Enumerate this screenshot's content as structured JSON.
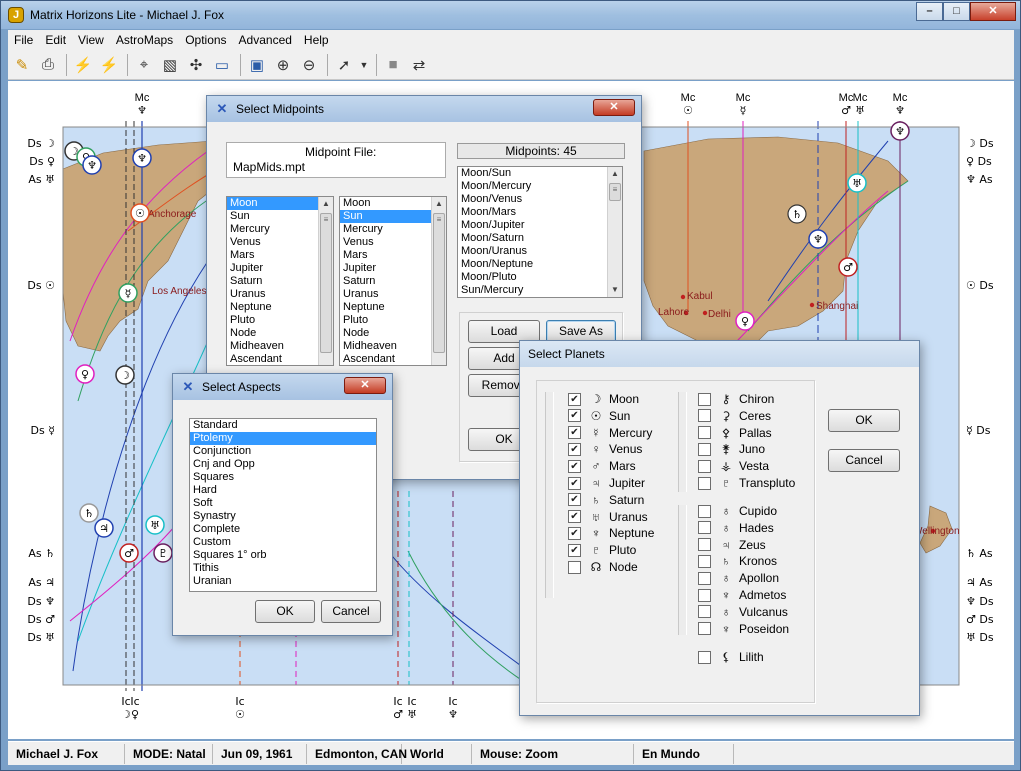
{
  "app": {
    "title": "Matrix Horizons Lite - Michael J. Fox",
    "icon_name": "app-logo-icon"
  },
  "window_controls": {
    "minimize": "–",
    "maximize": "□",
    "close": "✕"
  },
  "menu": [
    "File",
    "Edit",
    "View",
    "AstroMaps",
    "Options",
    "Advanced",
    "Help"
  ],
  "toolbar_icons": [
    "edit-chart-icon",
    "print-icon",
    "animate-icon",
    "animate-back-icon",
    "map-tool-icon",
    "select-region-icon",
    "planet-lines-icon",
    "screen-icon",
    "full-map-icon",
    "zoom-in-icon",
    "zoom-out-icon",
    "pointer-icon",
    "dropdown-arrow-icon",
    "stop-icon",
    "refresh-icon"
  ],
  "map": {
    "ocean_color": "#c9def5",
    "land_color": "#c9a77b",
    "cities": [
      "Anchorage",
      "Los Angeles",
      "Kabul",
      "Lahore",
      "Delhi",
      "Shanghai",
      "Wellington"
    ],
    "top_labels": [
      "Mc",
      "Mc",
      "Mc",
      "Mc",
      "Mc",
      "Mc",
      "Mc"
    ],
    "top_symbols": [
      "♆",
      "☉",
      "☿",
      "♂",
      "♅",
      "♆"
    ],
    "left_labels": [
      {
        "ang": "Ds",
        "sym": "☽"
      },
      {
        "ang": "Ds",
        "sym": "♀"
      },
      {
        "ang": "As",
        "sym": "♅"
      },
      {
        "ang": "Ds",
        "sym": "☉"
      },
      {
        "ang": "Ds",
        "sym": "☿"
      },
      {
        "ang": "As",
        "sym": "♄"
      },
      {
        "ang": "As",
        "sym": "♃"
      },
      {
        "ang": "Ds",
        "sym": "♆"
      },
      {
        "ang": "Ds",
        "sym": "♂"
      },
      {
        "ang": "Ds",
        "sym": "♅"
      }
    ],
    "right_labels": [
      {
        "ang": "Ds",
        "sym": "☽"
      },
      {
        "ang": "Ds",
        "sym": "♀"
      },
      {
        "ang": "As",
        "sym": "♆"
      },
      {
        "ang": "Ds",
        "sym": "☉"
      },
      {
        "ang": "Ds",
        "sym": "☿"
      },
      {
        "ang": "As",
        "sym": "♄"
      },
      {
        "ang": "As",
        "sym": "♃"
      },
      {
        "ang": "Ds",
        "sym": "♆"
      },
      {
        "ang": "Ds",
        "sym": "♂"
      },
      {
        "ang": "Ds",
        "sym": "♅"
      }
    ],
    "bottom_labels": [
      {
        "ang": "Ic",
        "sym": "☽"
      },
      {
        "ang": "Ic",
        "sym": "♀"
      },
      {
        "ang": "Ic",
        "sym": "☉"
      },
      {
        "ang": "Ic",
        "sym": "♂"
      },
      {
        "ang": "Ic",
        "sym": "♅"
      },
      {
        "ang": "Ic",
        "sym": "♆"
      }
    ]
  },
  "midpoints_dialog": {
    "title": "Select Midpoints",
    "file_label": "Midpoint File:",
    "file_value": "MapMids.mpt",
    "count_label": "Midpoints: 45",
    "list_a": [
      "Moon",
      "Sun",
      "Mercury",
      "Venus",
      "Mars",
      "Jupiter",
      "Saturn",
      "Uranus",
      "Neptune",
      "Pluto",
      "Node",
      "Midheaven",
      "Ascendant"
    ],
    "list_a_selected": "Moon",
    "list_b": [
      "Moon",
      "Sun",
      "Mercury",
      "Venus",
      "Mars",
      "Jupiter",
      "Saturn",
      "Uranus",
      "Neptune",
      "Pluto",
      "Node",
      "Midheaven",
      "Ascendant"
    ],
    "list_b_selected": "Sun",
    "pairs": [
      "Moon/Sun",
      "Moon/Mercury",
      "Moon/Venus",
      "Moon/Mars",
      "Moon/Jupiter",
      "Moon/Saturn",
      "Moon/Uranus",
      "Moon/Neptune",
      "Moon/Pluto",
      "Sun/Mercury"
    ],
    "buttons": {
      "load": "Load",
      "save_as": "Save As",
      "add": "Add",
      "remove": "Remove",
      "ok": "OK"
    }
  },
  "aspects_dialog": {
    "title": "Select Aspects",
    "items": [
      "Standard",
      "Ptolemy",
      "Conjunction",
      "Cnj and Opp",
      "Squares",
      "Hard",
      "Soft",
      "Synastry",
      "Complete",
      "Custom",
      "Squares 1° orb",
      "Tithis",
      "Uranian"
    ],
    "selected": "Ptolemy",
    "ok": "OK",
    "cancel": "Cancel"
  },
  "planets_dialog": {
    "title": "Select Planets",
    "col1": [
      {
        "name": "Moon",
        "sym": "☽",
        "checked": true
      },
      {
        "name": "Sun",
        "sym": "☉",
        "checked": true
      },
      {
        "name": "Mercury",
        "sym": "☿",
        "checked": true
      },
      {
        "name": "Venus",
        "sym": "♀",
        "checked": true
      },
      {
        "name": "Mars",
        "sym": "♂",
        "checked": true
      },
      {
        "name": "Jupiter",
        "sym": "♃",
        "checked": true
      },
      {
        "name": "Saturn",
        "sym": "♄",
        "checked": true
      },
      {
        "name": "Uranus",
        "sym": "♅",
        "checked": true
      },
      {
        "name": "Neptune",
        "sym": "♆",
        "checked": true
      },
      {
        "name": "Pluto",
        "sym": "♇",
        "checked": true
      },
      {
        "name": "Node",
        "sym": "☊",
        "checked": false
      }
    ],
    "col2a": [
      {
        "name": "Chiron",
        "sym": "⚷",
        "checked": false
      },
      {
        "name": "Ceres",
        "sym": "⚳",
        "checked": false
      },
      {
        "name": "Pallas",
        "sym": "⚴",
        "checked": false
      },
      {
        "name": "Juno",
        "sym": "⚵",
        "checked": false
      },
      {
        "name": "Vesta",
        "sym": "⚶",
        "checked": false
      },
      {
        "name": "Transpluto",
        "sym": "♇",
        "checked": false
      }
    ],
    "col2b": [
      {
        "name": "Cupido",
        "sym": "♁",
        "checked": false
      },
      {
        "name": "Hades",
        "sym": "♁",
        "checked": false
      },
      {
        "name": "Zeus",
        "sym": "♃",
        "checked": false
      },
      {
        "name": "Kronos",
        "sym": "♄",
        "checked": false
      },
      {
        "name": "Apollon",
        "sym": "♁",
        "checked": false
      },
      {
        "name": "Admetos",
        "sym": "♆",
        "checked": false
      },
      {
        "name": "Vulcanus",
        "sym": "♁",
        "checked": false
      },
      {
        "name": "Poseidon",
        "sym": "♆",
        "checked": false
      }
    ],
    "lilith": {
      "name": "Lilith",
      "sym": "⚸",
      "checked": false
    },
    "ok": "OK",
    "cancel": "Cancel"
  },
  "status": [
    "Michael J. Fox",
    "MODE: Natal",
    "Jun 09, 1961",
    "Edmonton, CAN",
    "World",
    "Mouse: Zoom",
    "En Mundo"
  ]
}
